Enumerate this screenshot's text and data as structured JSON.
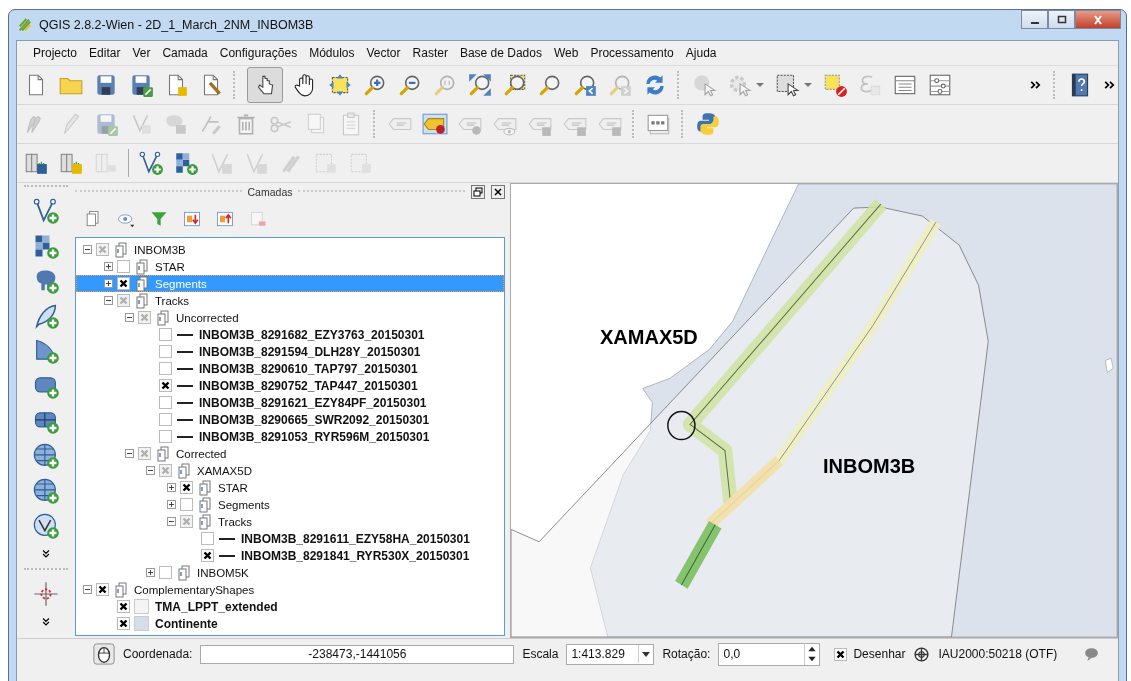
{
  "window": {
    "title": "QGIS 2.8.2-Wien - 2D_1_March_2NM_INBOM3B"
  },
  "menu": [
    "Projecto",
    "Editar",
    "Ver",
    "Camada",
    "Configurações",
    "Módulos",
    "Vector",
    "Raster",
    "Base de Dados",
    "Web",
    "Processamento",
    "Ajuda"
  ],
  "layers_panel": {
    "title": "Camadas"
  },
  "layers": [
    {
      "name": "INBOM3B",
      "kind": "group",
      "checked": true,
      "partial": true,
      "expanded": true,
      "selected": false,
      "children": [
        {
          "name": "STAR",
          "kind": "group",
          "checked": false,
          "partial": false,
          "expanded": false,
          "selected": false
        },
        {
          "name": "Segments",
          "kind": "group",
          "checked": true,
          "partial": false,
          "expanded": false,
          "selected": true
        },
        {
          "name": "Tracks",
          "kind": "group",
          "checked": true,
          "partial": true,
          "expanded": true,
          "selected": false,
          "children": [
            {
              "name": "Uncorrected",
              "kind": "group",
              "checked": true,
              "partial": true,
              "expanded": true,
              "selected": false,
              "children": [
                {
                  "name": "INBOM3B_8291682_EZY3763_20150301",
                  "kind": "line",
                  "checked": false,
                  "partial": false,
                  "selected": false
                },
                {
                  "name": "INBOM3B_8291594_DLH28Y_20150301",
                  "kind": "line",
                  "checked": false,
                  "partial": false,
                  "selected": false
                },
                {
                  "name": "INBOM3B_8290610_TAP797_20150301",
                  "kind": "line",
                  "checked": false,
                  "partial": false,
                  "selected": false
                },
                {
                  "name": "INBOM3B_8290752_TAP447_20150301",
                  "kind": "line",
                  "checked": true,
                  "partial": false,
                  "selected": false
                },
                {
                  "name": "INBOM3B_8291621_EZY84PF_20150301",
                  "kind": "line",
                  "checked": false,
                  "partial": false,
                  "selected": false
                },
                {
                  "name": "INBOM3B_8290665_SWR2092_20150301",
                  "kind": "line",
                  "checked": false,
                  "partial": false,
                  "selected": false
                },
                {
                  "name": "INBOM3B_8291053_RYR596M_20150301",
                  "kind": "line",
                  "checked": false,
                  "partial": false,
                  "selected": false
                }
              ]
            },
            {
              "name": "Corrected",
              "kind": "group",
              "checked": true,
              "partial": true,
              "expanded": true,
              "selected": false,
              "children": [
                {
                  "name": "XAMAX5D",
                  "kind": "group",
                  "checked": true,
                  "partial": true,
                  "expanded": true,
                  "selected": false,
                  "children": [
                    {
                      "name": "STAR",
                      "kind": "group",
                      "checked": true,
                      "partial": false,
                      "expanded": false,
                      "selected": false
                    },
                    {
                      "name": "Segments",
                      "kind": "group",
                      "checked": false,
                      "partial": false,
                      "expanded": false,
                      "selected": false
                    },
                    {
                      "name": "Tracks",
                      "kind": "group",
                      "checked": true,
                      "partial": true,
                      "expanded": true,
                      "selected": false,
                      "children": [
                        {
                          "name": "INBOM3B_8291611_EZY58HA_20150301",
                          "kind": "line",
                          "checked": false,
                          "partial": false,
                          "selected": false
                        },
                        {
                          "name": "INBOM3B_8291841_RYR530X_20150301",
                          "kind": "line",
                          "checked": true,
                          "partial": false,
                          "selected": false
                        }
                      ]
                    }
                  ]
                },
                {
                  "name": "INBOM5K",
                  "kind": "group",
                  "checked": false,
                  "partial": false,
                  "expanded": false,
                  "selected": false
                }
              ]
            }
          ]
        }
      ]
    },
    {
      "name": "ComplementaryShapes",
      "kind": "group",
      "checked": true,
      "partial": false,
      "expanded": true,
      "selected": false,
      "children": [
        {
          "name": "TMA_LPPT_extended",
          "kind": "fill",
          "checked": true,
          "partial": false,
          "selected": false,
          "color": "#f4f4f4"
        },
        {
          "name": "Continente",
          "kind": "fill",
          "checked": true,
          "partial": false,
          "selected": false,
          "color": "#d5dde8"
        }
      ]
    }
  ],
  "map": {
    "labels": [
      "XAMAX5D",
      "INBOM3B"
    ]
  },
  "status_bar": {
    "coordinate_label": "Coordenada:",
    "coordinate": "-238473,-1441056",
    "scale_label": "Escala",
    "scale": "1:413.829",
    "rotation_label": "Rotação:",
    "rotation": "0,0",
    "render": {
      "label": "Desenhar",
      "checked": true
    },
    "crs": "IAU2000:50218 (OTF)"
  }
}
